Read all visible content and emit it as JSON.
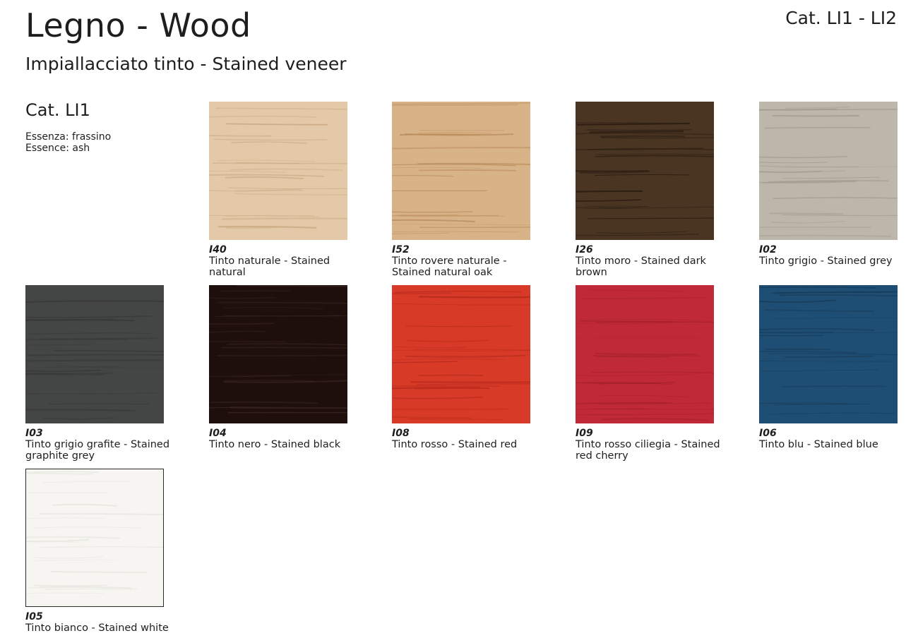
{
  "header": {
    "title": "Legno - Wood",
    "category_range": "Cat. LI1 - LI2",
    "subtitle": "Impiallacciato tinto - Stained veneer"
  },
  "category": {
    "heading": "Cat. LI1",
    "essence_it": "Essenza: frassino",
    "essence_en": "Essence: ash"
  },
  "swatches": [
    {
      "code": "I40",
      "label": "Tinto naturale - Stained natural",
      "color": "#e3c9a8",
      "grain": "#c9a983"
    },
    {
      "code": "I52",
      "label": "Tinto rovere naturale - Stained natural oak",
      "color": "#d9b388",
      "grain": "#b98d5c"
    },
    {
      "code": "I26",
      "label": "Tinto moro - Stained dark brown",
      "color": "#4a3523",
      "grain": "#2a1c10"
    },
    {
      "code": "I02",
      "label": "Tinto grigio - Stained grey",
      "color": "#bdb6aa",
      "grain": "#9f978a"
    },
    {
      "code": "I03",
      "label": "Tinto grigio grafite - Stained graphite grey",
      "color": "#444545",
      "grain": "#373838"
    },
    {
      "code": "I04",
      "label": "Tinto nero - Stained black",
      "color": "#1e0f0c",
      "grain": "#3a2620"
    },
    {
      "code": "I08",
      "label": "Tinto rosso - Stained red",
      "color": "#d83a28",
      "grain": "#b52a1b"
    },
    {
      "code": "I09",
      "label": "Tinto rosso ciliegia - Stained red cherry",
      "color": "#c02a38",
      "grain": "#a51f2c"
    },
    {
      "code": "I06",
      "label": "Tinto blu - Stained blue",
      "color": "#1f4e74",
      "grain": "#153a58"
    },
    {
      "code": "I05",
      "label": "Tinto bianco - Stained white",
      "color": "#f6f5f1",
      "grain": "#e6e5df"
    }
  ]
}
